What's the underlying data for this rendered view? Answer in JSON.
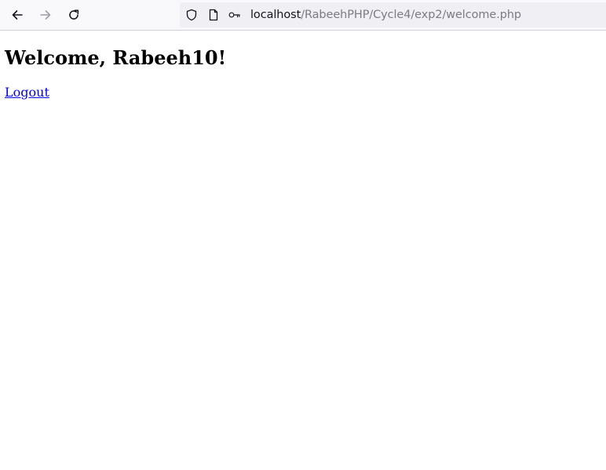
{
  "browser": {
    "url_host": "localhost",
    "url_path": "/RabeehPHP/Cycle4/exp2/welcome.php",
    "icons": {
      "back": "arrow-left",
      "forward": "arrow-right",
      "reload": "reload",
      "tracking": "shield",
      "page": "page",
      "permissions": "key"
    }
  },
  "page": {
    "heading": "Welcome, Rabeeh10!",
    "logout_label": "Logout"
  },
  "colors": {
    "link": "#0000ee",
    "toolbar_bg": "#f9f9fb",
    "urlbar_bg": "#f0f0f4"
  }
}
